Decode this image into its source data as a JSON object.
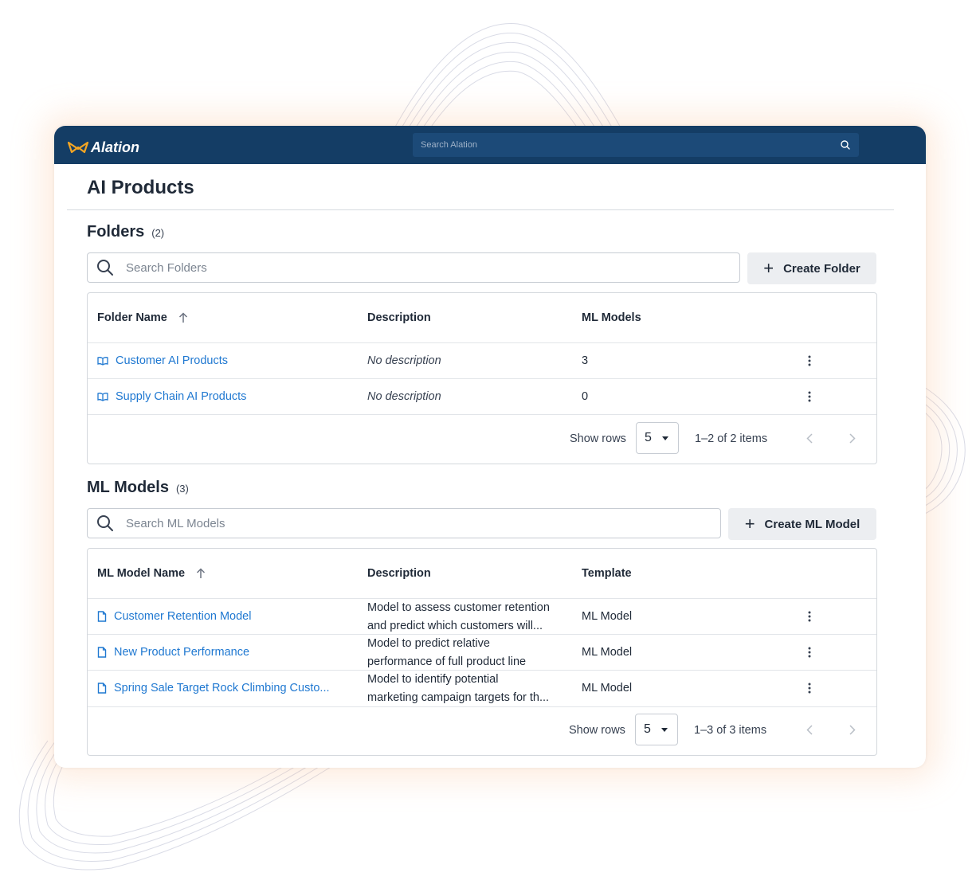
{
  "app": {
    "name": "Alation",
    "search_placeholder": "Search Alation"
  },
  "page": {
    "title": "AI Products"
  },
  "folders": {
    "title": "Folders",
    "count": "(2)",
    "search_placeholder": "Search Folders",
    "create_label": "Create Folder",
    "columns": [
      "Folder Name",
      "Description",
      "ML Models"
    ],
    "rows": [
      {
        "name": "Customer AI Products",
        "description": "No description",
        "ml_models": "3"
      },
      {
        "name": "Supply Chain AI Products",
        "description": "No description",
        "ml_models": "0"
      }
    ],
    "show_rows_label": "Show rows",
    "rows_per_page": "5",
    "range": "1–2 of 2 items"
  },
  "ml_models": {
    "title": "ML Models",
    "count": "(3)",
    "search_placeholder": "Search ML Models",
    "create_label": "Create ML Model",
    "columns": [
      "ML Model Name",
      "Description",
      "Template"
    ],
    "rows": [
      {
        "name": "Customer Retention Model",
        "description_line1": "Model to assess customer retention",
        "description_line2": "and predict which customers will...",
        "template": "ML Model"
      },
      {
        "name": "New Product Performance",
        "description_line1": "Model to predict relative",
        "description_line2": "performance of full product line",
        "template": "ML Model"
      },
      {
        "name": "Spring Sale Target Rock Climbing Custo...",
        "description_line1": "Model to identify potential",
        "description_line2": "marketing campaign targets for th...",
        "template": "ML Model"
      }
    ],
    "show_rows_label": "Show rows",
    "rows_per_page": "5",
    "range": "1–3 of 3 items"
  },
  "colors": {
    "topbar": "#143d65",
    "link": "#1f78d1",
    "brand_accent": "#f5a623"
  },
  "icons": {
    "logo": "alation-bowtie-icon",
    "search": "search-icon",
    "folder": "book-open-icon",
    "model": "document-icon",
    "sort": "arrow-up-icon",
    "row_menu": "kebab-menu-icon",
    "prev": "chevron-left-icon",
    "next": "chevron-right-icon",
    "add": "plus-icon",
    "dropdown": "caret-down-icon"
  }
}
